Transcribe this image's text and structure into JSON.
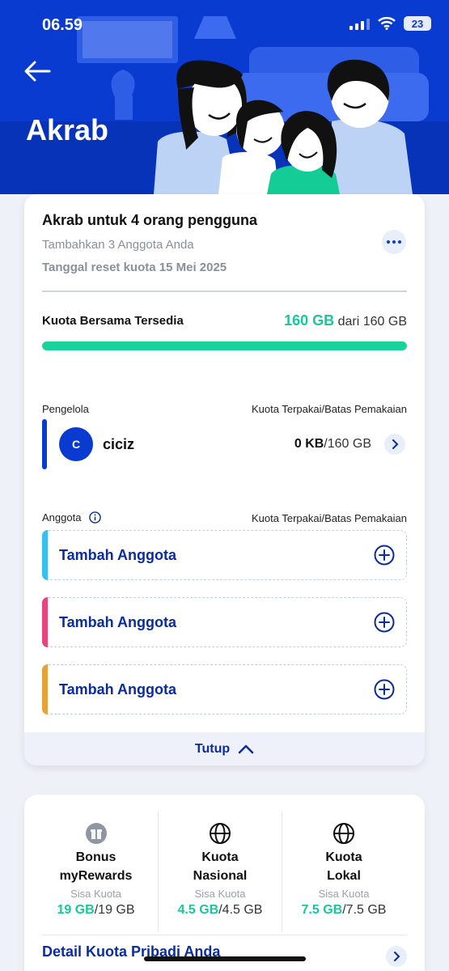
{
  "status_bar": {
    "time": "06.59",
    "battery": "23"
  },
  "header": {
    "title": "Akrab"
  },
  "plan": {
    "title": "Akrab untuk 4 orang pengguna",
    "subtitle": "Tambahkan 3 Anggota Anda",
    "reset_date": "Tanggal reset kuota 15 Mei 2025",
    "shared_quota_label": "Kuota Bersama Tersedia",
    "shared_quota_available": "160 GB",
    "shared_quota_total": " dari 160 GB",
    "shared_quota_fraction": 1.0
  },
  "manager": {
    "section_label": "Pengelola",
    "usage_header": "Kuota Terpakai/Batas Pemakaian",
    "avatar_initial": "C",
    "name": "ciciz",
    "used": "0 KB",
    "limit": "/160 GB"
  },
  "members": {
    "section_label": "Anggota",
    "usage_header": "Kuota Terpakai/Batas Pemakaian",
    "slots": [
      {
        "label": "Tambah Anggota",
        "accent": "#38c0f0"
      },
      {
        "label": "Tambah Anggota",
        "accent": "#e8457c"
      },
      {
        "label": "Tambah Anggota",
        "accent": "#e5a23a"
      }
    ]
  },
  "collapse_label": "Tutup",
  "personal_quota": {
    "columns": [
      {
        "name_line1": "Bonus",
        "name_line2": "myRewards",
        "sub": "Sisa Kuota",
        "remaining": "19 GB",
        "total": "/19 GB",
        "icon": "gift-icon"
      },
      {
        "name_line1": "Kuota",
        "name_line2": "Nasional",
        "sub": "Sisa Kuota",
        "remaining": "4.5 GB",
        "total": "/4.5 GB",
        "icon": "globe-icon"
      },
      {
        "name_line1": "Kuota",
        "name_line2": "Lokal",
        "sub": "Sisa Kuota",
        "remaining": "7.5 GB",
        "total": "/7.5 GB",
        "icon": "globe-icon"
      }
    ],
    "detail_link": "Detail Kuota Pribadi Anda"
  },
  "colors": {
    "primary": "#0a3bd0",
    "accent_green": "#19d39d",
    "link_blue": "#0a2c9e"
  }
}
